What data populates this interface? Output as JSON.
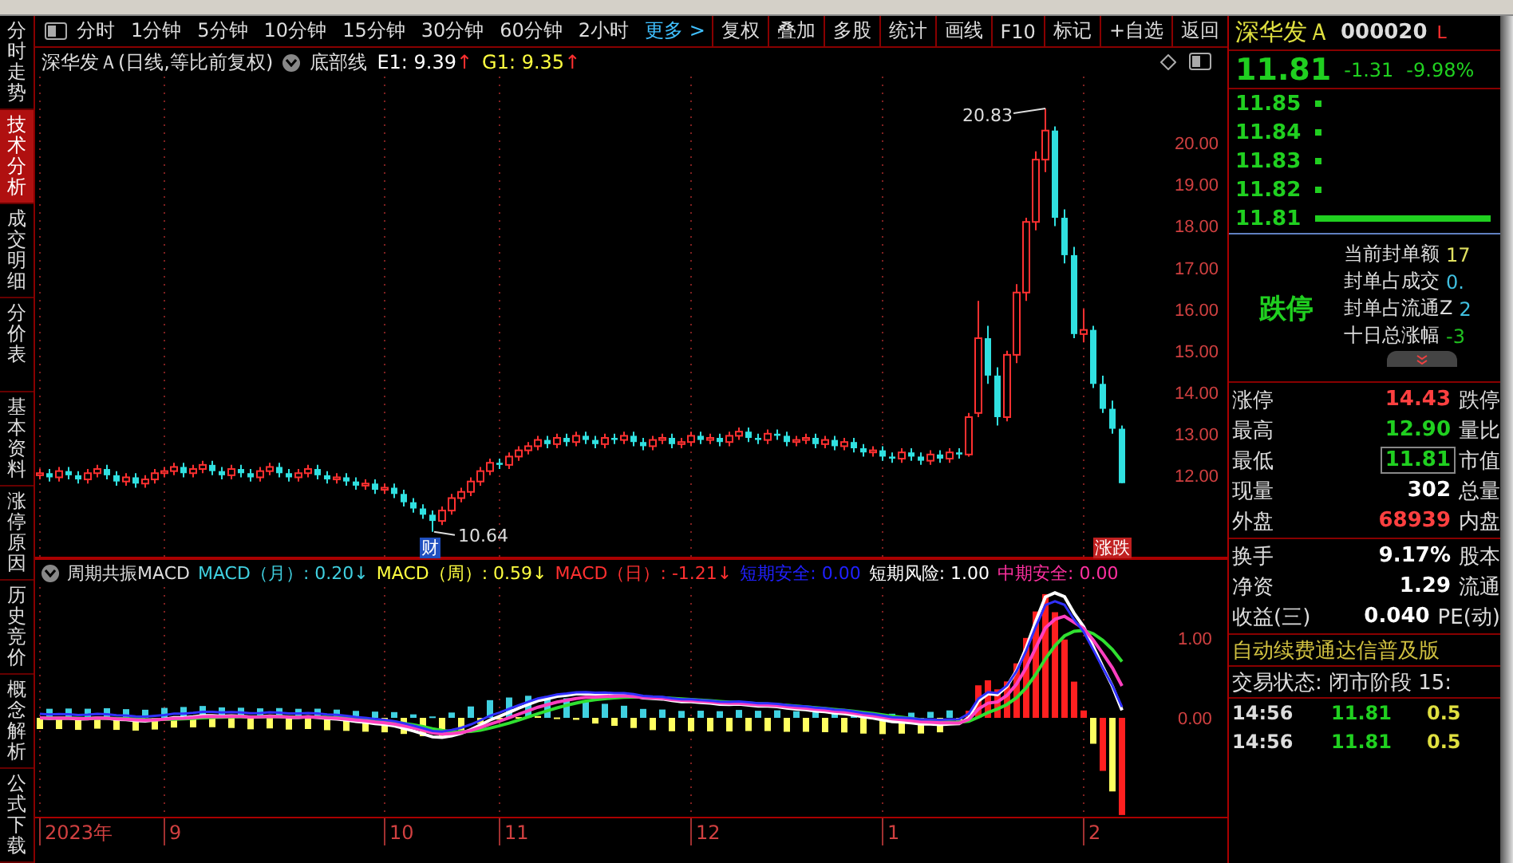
{
  "side_tabs": [
    {
      "label": "分时走势",
      "selected": false
    },
    {
      "label": "技术分析",
      "selected": true
    },
    {
      "label": "成交明细",
      "selected": false
    },
    {
      "label": "分价表",
      "selected": false
    },
    {
      "label": "基本资料",
      "selected": false
    },
    {
      "label": "涨停原因",
      "selected": false
    },
    {
      "label": "历史竞价",
      "selected": false
    },
    {
      "label": "概念解析",
      "selected": false
    },
    {
      "label": "公式下载",
      "selected": false
    }
  ],
  "toolbar": {
    "periods": [
      "分时",
      "1分钟",
      "5分钟",
      "10分钟",
      "15分钟",
      "30分钟",
      "60分钟",
      "2小时"
    ],
    "more": "更多 >",
    "actions": [
      "复权",
      "叠加",
      "多股",
      "统计",
      "画线",
      "F10",
      "标记",
      "+自选",
      "返回"
    ]
  },
  "chart_title": {
    "name": "深华发Ａ(日线,等比前复权)",
    "indicator": "底部线",
    "values": [
      {
        "text": "E1: 9.39",
        "arrow": "↑",
        "color": "#ffffff"
      },
      {
        "text": "G1: 9.35",
        "arrow": "↑",
        "color": "#ffff40"
      }
    ]
  },
  "price_chart": {
    "chart_data": {
      "type": "candlestick",
      "grid": true,
      "ylim": [
        10.0,
        21.6
      ],
      "yticks": [
        {
          "value": 12,
          "label": "12.00"
        },
        {
          "value": 13,
          "label": "13.00"
        },
        {
          "value": 14,
          "label": "14.00"
        },
        {
          "value": 15,
          "label": "15.00"
        },
        {
          "value": 16,
          "label": "16.00"
        },
        {
          "value": 17,
          "label": "17.00"
        },
        {
          "value": 18,
          "label": "18.00"
        },
        {
          "value": 19,
          "label": "19.00"
        },
        {
          "value": 20,
          "label": "20.00"
        }
      ],
      "ohlc": [
        [
          12.0,
          12.15,
          11.9,
          12.05
        ],
        [
          12.05,
          12.15,
          11.85,
          11.95
        ],
        [
          11.95,
          12.2,
          11.85,
          12.1
        ],
        [
          12.1,
          12.2,
          11.9,
          12.0
        ],
        [
          12.0,
          12.1,
          11.8,
          11.9
        ],
        [
          11.9,
          12.15,
          11.8,
          12.05
        ],
        [
          12.05,
          12.25,
          11.95,
          12.15
        ],
        [
          12.15,
          12.25,
          11.9,
          12.0
        ],
        [
          12.0,
          12.1,
          11.75,
          11.85
        ],
        [
          11.85,
          12.05,
          11.75,
          11.95
        ],
        [
          11.95,
          12.05,
          11.7,
          11.8
        ],
        [
          11.8,
          12.0,
          11.7,
          11.9
        ],
        [
          11.9,
          12.15,
          11.8,
          12.05
        ],
        [
          12.05,
          12.2,
          11.95,
          12.1
        ],
        [
          12.1,
          12.3,
          12.0,
          12.2
        ],
        [
          12.2,
          12.3,
          11.95,
          12.05
        ],
        [
          12.05,
          12.25,
          11.95,
          12.15
        ],
        [
          12.15,
          12.35,
          12.05,
          12.25
        ],
        [
          12.25,
          12.35,
          12.0,
          12.1
        ],
        [
          12.1,
          12.2,
          11.9,
          12.0
        ],
        [
          12.0,
          12.25,
          11.9,
          12.15
        ],
        [
          12.15,
          12.25,
          11.95,
          12.05
        ],
        [
          12.05,
          12.15,
          11.85,
          11.95
        ],
        [
          11.95,
          12.2,
          11.85,
          12.1
        ],
        [
          12.1,
          12.3,
          12.0,
          12.2
        ],
        [
          12.2,
          12.3,
          11.95,
          12.05
        ],
        [
          12.05,
          12.15,
          11.85,
          11.95
        ],
        [
          11.95,
          12.15,
          11.85,
          12.05
        ],
        [
          12.05,
          12.25,
          11.95,
          12.15
        ],
        [
          12.15,
          12.25,
          11.9,
          12.0
        ],
        [
          12.0,
          12.1,
          11.8,
          11.9
        ],
        [
          11.9,
          12.05,
          11.8,
          11.95
        ],
        [
          11.95,
          12.05,
          11.75,
          11.85
        ],
        [
          11.85,
          11.95,
          11.65,
          11.75
        ],
        [
          11.75,
          11.9,
          11.65,
          11.8
        ],
        [
          11.8,
          11.9,
          11.55,
          11.65
        ],
        [
          11.65,
          11.8,
          11.55,
          11.7
        ],
        [
          11.7,
          11.8,
          11.45,
          11.55
        ],
        [
          11.55,
          11.65,
          11.25,
          11.35
        ],
        [
          11.35,
          11.45,
          11.1,
          11.2
        ],
        [
          11.2,
          11.3,
          10.95,
          11.05
        ],
        [
          11.05,
          11.15,
          10.64,
          10.9
        ],
        [
          10.9,
          11.25,
          10.8,
          11.15
        ],
        [
          11.15,
          11.55,
          11.05,
          11.45
        ],
        [
          11.45,
          11.7,
          11.35,
          11.6
        ],
        [
          11.6,
          11.95,
          11.5,
          11.85
        ],
        [
          11.85,
          12.2,
          11.75,
          12.1
        ],
        [
          12.1,
          12.4,
          12.0,
          12.3
        ],
        [
          12.3,
          12.4,
          12.15,
          12.25
        ],
        [
          12.25,
          12.55,
          12.15,
          12.45
        ],
        [
          12.45,
          12.7,
          12.35,
          12.6
        ],
        [
          12.6,
          12.8,
          12.5,
          12.7
        ],
        [
          12.7,
          12.95,
          12.6,
          12.85
        ],
        [
          12.85,
          12.95,
          12.65,
          12.75
        ],
        [
          12.75,
          13.0,
          12.65,
          12.9
        ],
        [
          12.9,
          13.0,
          12.7,
          12.8
        ],
        [
          12.8,
          13.05,
          12.7,
          12.95
        ],
        [
          12.95,
          13.05,
          12.75,
          12.85
        ],
        [
          12.85,
          12.95,
          12.65,
          12.75
        ],
        [
          12.75,
          13.0,
          12.65,
          12.9
        ],
        [
          12.9,
          13.0,
          12.75,
          12.85
        ],
        [
          12.85,
          13.05,
          12.75,
          12.95
        ],
        [
          12.95,
          13.05,
          12.7,
          12.8
        ],
        [
          12.8,
          12.9,
          12.6,
          12.7
        ],
        [
          12.7,
          12.95,
          12.6,
          12.85
        ],
        [
          12.85,
          13.0,
          12.75,
          12.9
        ],
        [
          12.9,
          13.0,
          12.65,
          12.75
        ],
        [
          12.75,
          12.9,
          12.65,
          12.8
        ],
        [
          12.8,
          13.05,
          12.7,
          12.95
        ],
        [
          12.95,
          13.05,
          12.75,
          12.85
        ],
        [
          12.85,
          13.0,
          12.75,
          12.9
        ],
        [
          12.9,
          13.0,
          12.7,
          12.8
        ],
        [
          12.8,
          13.05,
          12.7,
          12.95
        ],
        [
          12.95,
          13.15,
          12.85,
          13.05
        ],
        [
          13.05,
          13.15,
          12.8,
          12.9
        ],
        [
          12.9,
          13.0,
          12.75,
          12.85
        ],
        [
          12.85,
          13.1,
          12.75,
          13.0
        ],
        [
          13.0,
          13.1,
          12.85,
          12.95
        ],
        [
          12.95,
          13.05,
          12.7,
          12.8
        ],
        [
          12.8,
          12.95,
          12.7,
          12.85
        ],
        [
          12.85,
          13.0,
          12.75,
          12.9
        ],
        [
          12.9,
          13.0,
          12.65,
          12.75
        ],
        [
          12.75,
          12.95,
          12.65,
          12.85
        ],
        [
          12.85,
          12.95,
          12.6,
          12.7
        ],
        [
          12.7,
          12.9,
          12.6,
          12.8
        ],
        [
          12.8,
          12.9,
          12.55,
          12.65
        ],
        [
          12.65,
          12.75,
          12.45,
          12.55
        ],
        [
          12.55,
          12.7,
          12.45,
          12.6
        ],
        [
          12.6,
          12.7,
          12.35,
          12.45
        ],
        [
          12.45,
          12.55,
          12.3,
          12.4
        ],
        [
          12.4,
          12.65,
          12.3,
          12.55
        ],
        [
          12.55,
          12.65,
          12.35,
          12.45
        ],
        [
          12.45,
          12.55,
          12.25,
          12.35
        ],
        [
          12.35,
          12.6,
          12.25,
          12.5
        ],
        [
          12.5,
          12.6,
          12.3,
          12.4
        ],
        [
          12.4,
          12.65,
          12.3,
          12.55
        ],
        [
          12.55,
          12.65,
          12.4,
          12.5
        ],
        [
          12.5,
          13.5,
          12.45,
          13.4
        ],
        [
          13.5,
          16.2,
          13.4,
          15.3
        ],
        [
          15.3,
          15.6,
          14.2,
          14.4
        ],
        [
          14.4,
          14.6,
          13.2,
          13.4
        ],
        [
          13.4,
          15.0,
          13.3,
          14.9
        ],
        [
          14.9,
          16.6,
          14.7,
          16.4
        ],
        [
          16.4,
          18.2,
          16.2,
          18.1
        ],
        [
          18.1,
          19.8,
          17.9,
          19.6
        ],
        [
          19.6,
          20.83,
          19.3,
          20.3
        ],
        [
          20.3,
          20.4,
          18.0,
          18.2
        ],
        [
          18.2,
          18.4,
          17.1,
          17.3
        ],
        [
          17.3,
          17.5,
          15.3,
          15.4
        ],
        [
          15.4,
          16.0,
          15.2,
          15.5
        ],
        [
          15.5,
          15.6,
          14.1,
          14.2
        ],
        [
          14.2,
          14.4,
          13.5,
          13.6
        ],
        [
          13.6,
          13.8,
          13.0,
          13.12
        ],
        [
          13.12,
          13.2,
          11.81,
          11.81
        ]
      ]
    }
  },
  "time_axis": [
    "2023年",
    "9",
    "10",
    "11",
    "12",
    "1",
    "2"
  ],
  "high_label": "20.83",
  "low_label": "10.64",
  "event_marks": [
    {
      "text": "财",
      "color": "#2050c0"
    },
    {
      "text": "涨跌",
      "color": "#c02020"
    }
  ],
  "indicator": {
    "name": "周期共振MACD",
    "items": [
      {
        "label": "MACD（月）: 0.20",
        "arrow": "↓",
        "color": "#40d0e0"
      },
      {
        "label": "MACD（周）: 0.59",
        "arrow": "↓",
        "color": "#ffff40"
      },
      {
        "label": "MACD（日）: -1.21",
        "arrow": "↓",
        "color": "#ff3030"
      },
      {
        "label": "短期安全: 0.00",
        "color": "#2020ff"
      },
      {
        "label": "短期风险: 1.00",
        "color": "#ffffff"
      },
      {
        "label": "中期安全: 0.00",
        "color": "#ff30a0"
      }
    ],
    "axis": [
      "1.00",
      "0.00"
    ]
  },
  "quote": {
    "name": "深华发Ａ",
    "code": "000020",
    "flag": "L",
    "price": "11.81",
    "change": "-1.31",
    "pct": "-9.98%",
    "book": [
      {
        "price": "11.85",
        "kind": "dot"
      },
      {
        "price": "11.84",
        "kind": "dot"
      },
      {
        "price": "11.83",
        "kind": "dot"
      },
      {
        "price": "11.82",
        "kind": "dot"
      },
      {
        "price": "11.81",
        "kind": "bar"
      }
    ],
    "status_big": "跌停",
    "seal": [
      {
        "label": "当前封单额",
        "value": "17",
        "color": "#e0e060"
      },
      {
        "label": "封单占成交",
        "value": "0.",
        "color": "#40c0e0"
      },
      {
        "label": "封单占流通Z",
        "value": "2",
        "color": "#40c0e0"
      },
      {
        "label": "十日总涨幅",
        "value": "-3",
        "color": "#20c020"
      }
    ],
    "stats": [
      {
        "label": "涨停",
        "value": "14.43",
        "label2": "跌停",
        "color": "#ff4040",
        "boxed": false
      },
      {
        "label": "最高",
        "value": "12.90",
        "label2": "量比",
        "color": "#20d020",
        "boxed": false
      },
      {
        "label": "最低",
        "value": "11.81",
        "label2": "市值",
        "color": "#20d020",
        "boxed": true
      },
      {
        "label": "现量",
        "value": "302",
        "label2": "总量",
        "color": "#ffffff",
        "boxed": false
      },
      {
        "label": "外盘",
        "value": "68939",
        "label2": "内盘",
        "color": "#ff4040",
        "boxed": false
      }
    ],
    "stats2": [
      {
        "label": "换手",
        "value": "9.17%",
        "label2": "股本"
      },
      {
        "label": "净资",
        "value": "1.29",
        "label2": "流通"
      },
      {
        "label": "收益(三)",
        "value": "0.040",
        "label2": "PE(动)"
      }
    ],
    "notice": "自动续费通达信普及版",
    "trade_status": "交易状态: 闭市阶段 15:",
    "ticks": [
      {
        "time": "14:56",
        "price": "11.81",
        "volume": "0.5"
      },
      {
        "time": "14:56",
        "price": "11.81",
        "volume": "0.5"
      }
    ]
  }
}
